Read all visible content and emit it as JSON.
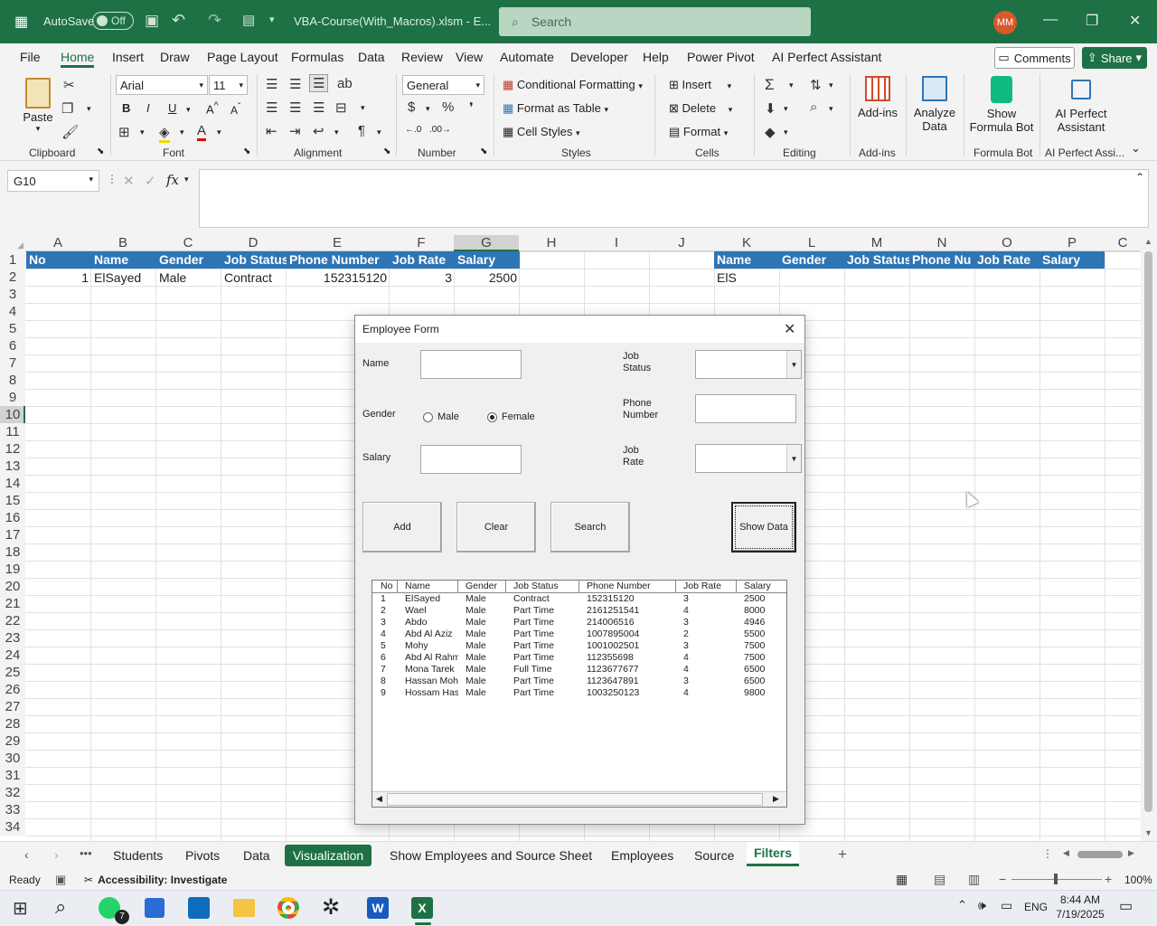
{
  "titlebar": {
    "autosave_label": "AutoSave",
    "autosave_state": "Off",
    "filename": "VBA-Course(With_Macros).xlsm  -  E...",
    "search_placeholder": "Search",
    "avatar_initials": "MM"
  },
  "menu": {
    "tabs": [
      "File",
      "Home",
      "Insert",
      "Draw",
      "Page Layout",
      "Formulas",
      "Data",
      "Review",
      "View",
      "Automate",
      "Developer",
      "Help",
      "Power Pivot",
      "AI Perfect Assistant"
    ],
    "active_tab": "Home",
    "comments_label": "Comments",
    "share_label": "Share"
  },
  "ribbon": {
    "clipboard": {
      "paste": "Paste",
      "group": "Clipboard"
    },
    "font": {
      "name": "Arial",
      "size": "11",
      "bold": "B",
      "italic": "I",
      "underline": "U",
      "group": "Font"
    },
    "alignment": {
      "group": "Alignment"
    },
    "number": {
      "format": "General",
      "group": "Number"
    },
    "styles": {
      "conditional": "Conditional Formatting",
      "table": "Format as Table",
      "cell_styles": "Cell Styles",
      "group": "Styles"
    },
    "cells": {
      "insert": "Insert",
      "delete": "Delete",
      "format": "Format",
      "group": "Cells"
    },
    "editing": {
      "group": "Editing"
    },
    "addins": {
      "label": "Add-ins",
      "group": "Add-ins"
    },
    "analyze": {
      "label1": "Analyze",
      "label2": "Data"
    },
    "formulabot": {
      "label1": "Show",
      "label2": "Formula Bot",
      "group": "Formula Bot"
    },
    "aiperfect": {
      "label1": "AI Perfect",
      "label2": "Assistant",
      "group": "AI Perfect Assi..."
    }
  },
  "formula_bar": {
    "name_box": "G10",
    "fx": "fx",
    "content": ""
  },
  "grid": {
    "columns": [
      "A",
      "B",
      "C",
      "D",
      "E",
      "F",
      "G",
      "H",
      "I",
      "J",
      "K",
      "L",
      "M",
      "N",
      "O",
      "P",
      "C"
    ],
    "rows": [
      "1",
      "2",
      "3",
      "4",
      "5",
      "6",
      "7",
      "8",
      "9",
      "10",
      "11",
      "12",
      "13",
      "14",
      "15",
      "16",
      "17",
      "18",
      "19",
      "20",
      "21",
      "22",
      "23",
      "24",
      "25",
      "26",
      "27",
      "28",
      "29",
      "30",
      "31",
      "32",
      "33",
      "34"
    ],
    "header_row": [
      "No",
      "Name",
      "Gender",
      "Job Status",
      "Phone Number",
      "Job Rate",
      "Salary"
    ],
    "data_row": [
      "1",
      "ElSayed",
      "Male",
      "Contract",
      "152315120",
      "3",
      "2500"
    ],
    "right_header": [
      "Name",
      "Gender",
      "Job Status",
      "Phone Nu",
      "Job Rate",
      "Salary"
    ],
    "right_data": "ElS"
  },
  "dialog": {
    "title": "Employee Form",
    "name_label": "Name",
    "gender_label": "Gender",
    "male": "Male",
    "female": "Female",
    "salary_label": "Salary",
    "job_status_label1": "Job",
    "job_status_label2": "Status",
    "phone_label1": "Phone",
    "phone_label2": "Number",
    "job_rate_label1": "Job",
    "job_rate_label2": "Rate",
    "buttons": {
      "add": "Add",
      "clear": "Clear",
      "search": "Search",
      "show": "Show Data"
    },
    "list_headers": [
      "No",
      "Name",
      "Gender",
      "Job Status",
      "Phone Number",
      "Job Rate",
      "Salary"
    ],
    "list_rows": [
      [
        "1",
        "ElSayed",
        "Male",
        "Contract",
        "152315120",
        "3",
        "2500"
      ],
      [
        "2",
        "Wael",
        "Male",
        "Part Time",
        "2161251541",
        "4",
        "8000"
      ],
      [
        "3",
        "Abdo",
        "Male",
        "Part Time",
        "214006516",
        "3",
        "4946"
      ],
      [
        "4",
        "Abd Al Aziz",
        "Male",
        "Part Time",
        "1007895004",
        "2",
        "5500"
      ],
      [
        "5",
        "Mohy",
        "Male",
        "Part Time",
        "1001002501",
        "3",
        "7500"
      ],
      [
        "6",
        "Abd Al Rahm",
        "Male",
        "Part Time",
        "112355698",
        "4",
        "7500"
      ],
      [
        "7",
        "Mona Tarek",
        "Male",
        "Full Time",
        "1123677677",
        "4",
        "6500"
      ],
      [
        "8",
        "Hassan Moh",
        "Male",
        "Part Time",
        "1123647891",
        "3",
        "6500"
      ],
      [
        "9",
        "Hossam Has",
        "Male",
        "Part Time",
        "1003250123",
        "4",
        "9800"
      ]
    ]
  },
  "sheet_tabs": [
    "Students",
    "Pivots",
    "Data",
    "Visualization",
    "Show Employees and Source Sheet",
    "Employees",
    "Source",
    "Filters"
  ],
  "active_sheet": "Filters",
  "status": {
    "ready": "Ready",
    "accessibility": "Accessibility: Investigate",
    "zoom": "100%"
  },
  "taskbar": {
    "time": "8:44 AM",
    "date": "7/19/2025",
    "lang": "ENG",
    "whatsapp_badge": "7"
  }
}
